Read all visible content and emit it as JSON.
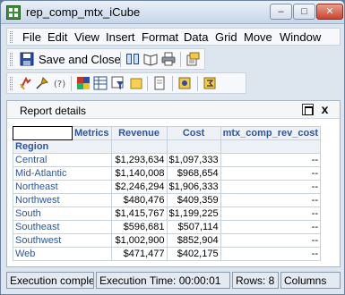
{
  "window": {
    "title": "rep_comp_mtx_iCube",
    "minimize_glyph": "–",
    "maximize_glyph": "□",
    "close_glyph": "✕"
  },
  "menu": {
    "items": [
      "File",
      "Edit",
      "View",
      "Insert",
      "Format",
      "Data",
      "Grid",
      "Move",
      "Window"
    ]
  },
  "toolbar": {
    "save_close_label": "Save and Close",
    "row1_icons": [
      "save-icon",
      "book-icon",
      "open-book-icon",
      "print-icon",
      "page-setup-icon"
    ],
    "row2_icons": [
      "pivot-icon",
      "drill-icon",
      "function-icon",
      "report-objects-icon",
      "data-view-icon",
      "filter-icon",
      "note-icon",
      "page-icon",
      "wizard-icon",
      "subtotals-icon"
    ]
  },
  "panel": {
    "title": "Report details",
    "maximize_glyph": "",
    "close_glyph": "x"
  },
  "grid": {
    "metrics_label": "Metrics",
    "row_header_label": "Region",
    "columns": [
      "Revenue",
      "Cost",
      "mtx_comp_rev_cost"
    ],
    "rows": [
      {
        "region": "Central",
        "revenue": "$1,293,634",
        "cost": "$1,097,333",
        "comp": "--"
      },
      {
        "region": "Mid-Atlantic",
        "revenue": "$1,140,008",
        "cost": "$968,654",
        "comp": "--"
      },
      {
        "region": "Northeast",
        "revenue": "$2,246,294",
        "cost": "$1,906,333",
        "comp": "--"
      },
      {
        "region": "Northwest",
        "revenue": "$480,476",
        "cost": "$409,359",
        "comp": "--"
      },
      {
        "region": "South",
        "revenue": "$1,415,767",
        "cost": "$1,199,225",
        "comp": "--"
      },
      {
        "region": "Southeast",
        "revenue": "$596,681",
        "cost": "$507,114",
        "comp": "--"
      },
      {
        "region": "Southwest",
        "revenue": "$1,002,900",
        "cost": "$852,904",
        "comp": "--"
      },
      {
        "region": "Web",
        "revenue": "$471,477",
        "cost": "$402,175",
        "comp": "--"
      }
    ]
  },
  "status": {
    "execution": "Execution comple",
    "time": "Execution Time: 00:00:01",
    "rows": "Rows: 8",
    "columns": "Columns"
  }
}
